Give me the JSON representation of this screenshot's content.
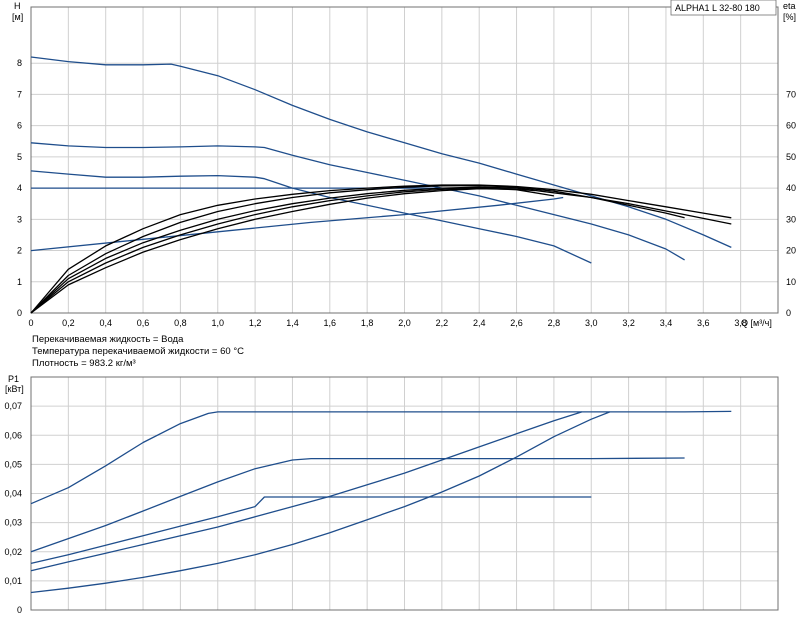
{
  "colors": {
    "pump_curve": "#1f4e8c",
    "efficiency_curve": "#000000",
    "grid": "#d0d0d0",
    "frame": "#707070"
  },
  "chart_data": [
    {
      "type": "line",
      "product_label": "ALPHA1 L 32-80   180",
      "ylabel": "H",
      "ylabel_unit": "[м]",
      "y2label": "eta",
      "y2label_unit": "[%]",
      "xlabel": "Q [м³/ч]",
      "xlim": [
        0,
        4.0
      ],
      "ylim": [
        0,
        9.8
      ],
      "y2lim": [
        0,
        98
      ],
      "grid": true,
      "x_ticks": [
        "0",
        "0,2",
        "0,4",
        "0,6",
        "0,8",
        "1,0",
        "1,2",
        "1,4",
        "1,6",
        "1,8",
        "2,0",
        "2,2",
        "2,4",
        "2,6",
        "2,8",
        "3,0",
        "3,2",
        "3,4",
        "3,6",
        "3,8"
      ],
      "x_tick_values": [
        0,
        0.2,
        0.4,
        0.6,
        0.8,
        1.0,
        1.2,
        1.4,
        1.6,
        1.8,
        2.0,
        2.2,
        2.4,
        2.6,
        2.8,
        3.0,
        3.2,
        3.4,
        3.6,
        3.8
      ],
      "y_ticks": [
        "0",
        "1",
        "2",
        "3",
        "4",
        "5",
        "6",
        "7",
        "8"
      ],
      "y_tick_values": [
        0,
        1,
        2,
        3,
        4,
        5,
        6,
        7,
        8
      ],
      "y2_ticks": [
        "0",
        "10",
        "20",
        "30",
        "40",
        "50",
        "60",
        "70"
      ],
      "y2_tick_values": [
        0,
        10,
        20,
        30,
        40,
        50,
        60,
        70
      ],
      "series": [
        {
          "kind": "pump",
          "points": [
            [
              0,
              8.2
            ],
            [
              0.2,
              8.05
            ],
            [
              0.4,
              7.95
            ],
            [
              0.6,
              7.95
            ],
            [
              0.75,
              7.97
            ],
            [
              0.8,
              7.9
            ],
            [
              1.0,
              7.6
            ],
            [
              1.2,
              7.15
            ],
            [
              1.4,
              6.65
            ],
            [
              1.6,
              6.2
            ],
            [
              1.8,
              5.8
            ],
            [
              2.0,
              5.45
            ],
            [
              2.2,
              5.1
            ],
            [
              2.4,
              4.8
            ],
            [
              2.6,
              4.45
            ],
            [
              2.8,
              4.1
            ],
            [
              3.0,
              3.75
            ],
            [
              3.2,
              3.4
            ],
            [
              3.4,
              3.0
            ],
            [
              3.6,
              2.5
            ],
            [
              3.75,
              2.1
            ]
          ]
        },
        {
          "kind": "pump",
          "points": [
            [
              0,
              5.45
            ],
            [
              0.2,
              5.35
            ],
            [
              0.4,
              5.3
            ],
            [
              0.6,
              5.3
            ],
            [
              0.8,
              5.32
            ],
            [
              1.0,
              5.35
            ],
            [
              1.2,
              5.32
            ],
            [
              1.25,
              5.3
            ],
            [
              1.4,
              5.05
            ],
            [
              1.6,
              4.75
            ],
            [
              1.8,
              4.5
            ],
            [
              2.0,
              4.25
            ],
            [
              2.2,
              4.0
            ],
            [
              2.4,
              3.75
            ],
            [
              2.6,
              3.45
            ],
            [
              2.8,
              3.15
            ],
            [
              3.0,
              2.85
            ],
            [
              3.2,
              2.5
            ],
            [
              3.4,
              2.05
            ],
            [
              3.5,
              1.7
            ]
          ]
        },
        {
          "kind": "pump",
          "points": [
            [
              0,
              4.55
            ],
            [
              0.2,
              4.45
            ],
            [
              0.4,
              4.35
            ],
            [
              0.6,
              4.35
            ],
            [
              0.8,
              4.38
            ],
            [
              1.0,
              4.4
            ],
            [
              1.2,
              4.35
            ],
            [
              1.25,
              4.3
            ],
            [
              1.4,
              4.0
            ],
            [
              1.6,
              3.7
            ],
            [
              1.8,
              3.45
            ],
            [
              2.0,
              3.2
            ],
            [
              2.2,
              2.95
            ],
            [
              2.4,
              2.7
            ],
            [
              2.6,
              2.45
            ],
            [
              2.8,
              2.15
            ],
            [
              3.0,
              1.6
            ]
          ]
        },
        {
          "kind": "pump",
          "points": [
            [
              0,
              4.0
            ],
            [
              0.5,
              4.0
            ],
            [
              1.0,
              4.0
            ],
            [
              1.5,
              4.0
            ],
            [
              2.0,
              4.0
            ],
            [
              2.5,
              4.0
            ],
            [
              2.6,
              4.0
            ]
          ]
        },
        {
          "kind": "pump",
          "points": [
            [
              0,
              2.0
            ],
            [
              0.5,
              2.3
            ],
            [
              1.0,
              2.6
            ],
            [
              1.5,
              2.9
            ],
            [
              2.0,
              3.15
            ],
            [
              2.5,
              3.45
            ],
            [
              2.8,
              3.65
            ],
            [
              2.85,
              3.7
            ]
          ]
        },
        {
          "kind": "eta",
          "points": [
            [
              0,
              0
            ],
            [
              0.2,
              14
            ],
            [
              0.4,
              21.5
            ],
            [
              0.6,
              27
            ],
            [
              0.8,
              31.5
            ],
            [
              1.0,
              34.5
            ],
            [
              1.2,
              36.5
            ],
            [
              1.4,
              38
            ],
            [
              1.6,
              39.2
            ],
            [
              1.8,
              40
            ],
            [
              2.0,
              40.6
            ],
            [
              2.2,
              41
            ],
            [
              2.4,
              41
            ],
            [
              2.6,
              40.5
            ],
            [
              2.8,
              39.5
            ],
            [
              3.0,
              38
            ],
            [
              3.2,
              36
            ],
            [
              3.4,
              34
            ],
            [
              3.6,
              32
            ],
            [
              3.75,
              30.5
            ]
          ]
        },
        {
          "kind": "eta",
          "points": [
            [
              0,
              0
            ],
            [
              0.2,
              12
            ],
            [
              0.4,
              19
            ],
            [
              0.6,
              24.5
            ],
            [
              0.8,
              29
            ],
            [
              1.0,
              32.5
            ],
            [
              1.2,
              35
            ],
            [
              1.4,
              37
            ],
            [
              1.6,
              38.5
            ],
            [
              1.8,
              39.5
            ],
            [
              2.0,
              40.3
            ],
            [
              2.2,
              40.7
            ],
            [
              2.4,
              40.8
            ],
            [
              2.6,
              40.3
            ],
            [
              2.8,
              39
            ],
            [
              3.0,
              37
            ],
            [
              3.2,
              34.5
            ],
            [
              3.4,
              32
            ],
            [
              3.5,
              30.5
            ]
          ]
        },
        {
          "kind": "eta",
          "points": [
            [
              0,
              0
            ],
            [
              0.2,
              11
            ],
            [
              0.4,
              17.5
            ],
            [
              0.6,
              22.5
            ],
            [
              0.8,
              26.5
            ],
            [
              1.0,
              30
            ],
            [
              1.2,
              32.8
            ],
            [
              1.4,
              35
            ],
            [
              1.6,
              36.8
            ],
            [
              1.8,
              38.2
            ],
            [
              2.0,
              39.3
            ],
            [
              2.2,
              40
            ],
            [
              2.4,
              40.3
            ],
            [
              2.6,
              40
            ],
            [
              2.8,
              38.5
            ],
            [
              3.0,
              37
            ],
            [
              3.2,
              35
            ],
            [
              3.5,
              31.5
            ],
            [
              3.75,
              28.5
            ]
          ]
        },
        {
          "kind": "eta",
          "points": [
            [
              0,
              0
            ],
            [
              0.2,
              10
            ],
            [
              0.4,
              16
            ],
            [
              0.6,
              21
            ],
            [
              0.8,
              25
            ],
            [
              1.0,
              28.5
            ],
            [
              1.2,
              31.5
            ],
            [
              1.4,
              34
            ],
            [
              1.6,
              36
            ],
            [
              1.8,
              37.5
            ],
            [
              2.0,
              38.8
            ],
            [
              2.2,
              39.6
            ],
            [
              2.4,
              40
            ],
            [
              2.6,
              39.5
            ],
            [
              2.8,
              37.5
            ]
          ]
        },
        {
          "kind": "eta",
          "points": [
            [
              0,
              0
            ],
            [
              0.2,
              9
            ],
            [
              0.4,
              14.5
            ],
            [
              0.6,
              19.5
            ],
            [
              0.8,
              23.5
            ],
            [
              1.0,
              27
            ],
            [
              1.2,
              30
            ],
            [
              1.4,
              32.5
            ],
            [
              1.6,
              34.8
            ],
            [
              1.8,
              36.8
            ],
            [
              2.0,
              38.2
            ],
            [
              2.2,
              39.2
            ],
            [
              2.4,
              39.8
            ],
            [
              2.6,
              39.6
            ],
            [
              2.7,
              39.2
            ]
          ]
        }
      ]
    },
    {
      "type": "line",
      "ylabel": "P1",
      "ylabel_unit": "[кВт]",
      "xlim": [
        0,
        4.0
      ],
      "ylim": [
        0,
        0.08
      ],
      "grid": true,
      "y_ticks": [
        "0",
        "0,01",
        "0,02",
        "0,03",
        "0,04",
        "0,05",
        "0,06",
        "0,07"
      ],
      "y_tick_values": [
        0,
        0.01,
        0.02,
        0.03,
        0.04,
        0.05,
        0.06,
        0.07
      ],
      "series": [
        {
          "kind": "pump",
          "points": [
            [
              0,
              0.0365
            ],
            [
              0.2,
              0.042
            ],
            [
              0.4,
              0.0495
            ],
            [
              0.6,
              0.0575
            ],
            [
              0.8,
              0.064
            ],
            [
              0.95,
              0.0675
            ],
            [
              1.0,
              0.068
            ],
            [
              1.5,
              0.068
            ],
            [
              2.0,
              0.068
            ],
            [
              2.5,
              0.068
            ],
            [
              3.0,
              0.068
            ],
            [
              3.5,
              0.068
            ],
            [
              3.75,
              0.0682
            ]
          ]
        },
        {
          "kind": "pump",
          "points": [
            [
              0,
              0.02
            ],
            [
              0.2,
              0.0245
            ],
            [
              0.4,
              0.029
            ],
            [
              0.6,
              0.034
            ],
            [
              0.8,
              0.039
            ],
            [
              1.0,
              0.044
            ],
            [
              1.2,
              0.0485
            ],
            [
              1.4,
              0.0515
            ],
            [
              1.5,
              0.052
            ],
            [
              2.0,
              0.052
            ],
            [
              2.5,
              0.052
            ],
            [
              3.0,
              0.052
            ],
            [
              3.5,
              0.0522
            ]
          ]
        },
        {
          "kind": "pump",
          "points": [
            [
              0,
              0.016
            ],
            [
              0.2,
              0.019
            ],
            [
              0.4,
              0.0222
            ],
            [
              0.6,
              0.0255
            ],
            [
              0.8,
              0.0288
            ],
            [
              1.0,
              0.032
            ],
            [
              1.2,
              0.0355
            ],
            [
              1.25,
              0.0388
            ],
            [
              1.5,
              0.0388
            ],
            [
              2.0,
              0.0388
            ],
            [
              2.5,
              0.0388
            ],
            [
              3.0,
              0.0388
            ]
          ]
        },
        {
          "kind": "pump",
          "points": [
            [
              0,
              0.0135
            ],
            [
              0.2,
              0.0165
            ],
            [
              0.4,
              0.0195
            ],
            [
              0.6,
              0.0225
            ],
            [
              0.8,
              0.0255
            ],
            [
              1.0,
              0.0285
            ],
            [
              1.2,
              0.032
            ],
            [
              1.4,
              0.0355
            ],
            [
              1.6,
              0.039
            ],
            [
              1.8,
              0.043
            ],
            [
              2.0,
              0.047
            ],
            [
              2.2,
              0.0515
            ],
            [
              2.4,
              0.056
            ],
            [
              2.6,
              0.0605
            ],
            [
              2.8,
              0.065
            ],
            [
              2.95,
              0.068
            ]
          ]
        },
        {
          "kind": "pump",
          "points": [
            [
              0,
              0.006
            ],
            [
              0.2,
              0.0075
            ],
            [
              0.4,
              0.0092
            ],
            [
              0.6,
              0.0112
            ],
            [
              0.8,
              0.0135
            ],
            [
              1.0,
              0.016
            ],
            [
              1.2,
              0.019
            ],
            [
              1.4,
              0.0225
            ],
            [
              1.6,
              0.0265
            ],
            [
              1.8,
              0.031
            ],
            [
              2.0,
              0.0355
            ],
            [
              2.2,
              0.0405
            ],
            [
              2.4,
              0.046
            ],
            [
              2.6,
              0.0525
            ],
            [
              2.8,
              0.0595
            ],
            [
              3.0,
              0.0655
            ],
            [
              3.1,
              0.068
            ]
          ]
        }
      ]
    }
  ],
  "notes": {
    "liquid": "Перекачиваемая жидкость = Вода",
    "temperature": "Температура перекачиваемой жидкости = 60 °C",
    "density": "Плотность = 983.2 кг/м³"
  }
}
